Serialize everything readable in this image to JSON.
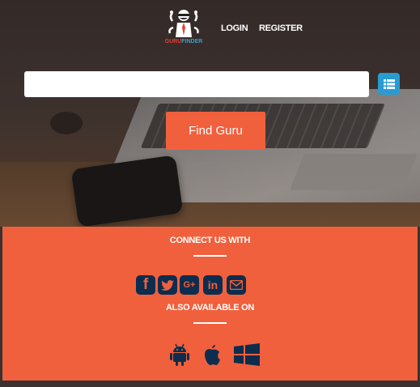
{
  "header": {
    "logo_text_primary": "GURU",
    "logo_text_secondary": "FINDER",
    "login_label": "LOGIN",
    "register_label": "REGISTER"
  },
  "search": {
    "value": "",
    "placeholder": "",
    "list_icon": "list-icon",
    "button_label": "Find Guru"
  },
  "connect": {
    "heading": "CONNECT US WITH",
    "icons": [
      "facebook-icon",
      "twitter-icon",
      "google-plus-icon",
      "linkedin-icon",
      "mail-icon"
    ]
  },
  "available": {
    "heading": "ALSO AVAILABLE ON",
    "icons": [
      "android-icon",
      "apple-icon",
      "windows-icon"
    ]
  },
  "colors": {
    "accent": "#f0603d",
    "icon_navy": "#0d2d4e",
    "list_button": "#2a9bd2",
    "logo_red": "#e53f35",
    "logo_blue": "#2fa4d7"
  }
}
